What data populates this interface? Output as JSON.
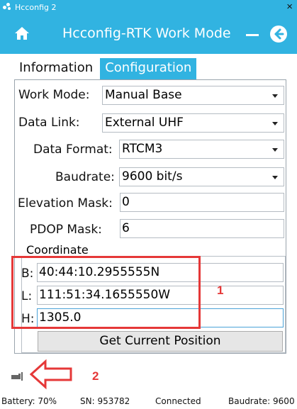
{
  "window": {
    "title": "Hcconfig 2",
    "close_glyph": "×"
  },
  "header": {
    "title": "Hcconfig-RTK Work Mode",
    "home_icon": "home-icon",
    "minimize_icon": "minimize-icon",
    "back_icon": "back-arrow-icon"
  },
  "tabs": [
    {
      "label": "Information",
      "active": false
    },
    {
      "label": "Configuration",
      "active": true
    }
  ],
  "form": {
    "work_mode": {
      "label": "Work Mode:",
      "value": "Manual Base"
    },
    "data_link": {
      "label": "Data Link:",
      "value": "External UHF"
    },
    "data_format": {
      "label": "Data Format:",
      "value": "RTCM3"
    },
    "baudrate": {
      "label": "Baudrate:",
      "value": "9600 bit/s"
    },
    "elevation_mask": {
      "label": "Elevation Mask:",
      "value": "0"
    },
    "pdop_mask": {
      "label": "PDOP Mask:",
      "value": "6"
    }
  },
  "coordinate": {
    "legend": "Coordinate",
    "b": {
      "label": "B:",
      "value": "40:44:10.2955555N"
    },
    "l": {
      "label": "L:",
      "value": "111:51:34.1655550W"
    },
    "h": {
      "label": "H:",
      "value": "1305.0"
    },
    "get_button": "Get Current Position"
  },
  "annotations": {
    "box_number": "1",
    "arrow_number": "2",
    "color": "#e53838"
  },
  "status": {
    "battery": "Battery: 70%",
    "sn": "SN: 953782",
    "connection": "Connected",
    "baudrate": "Baudrate: 9600"
  },
  "colors": {
    "accent": "#31b3e1"
  }
}
